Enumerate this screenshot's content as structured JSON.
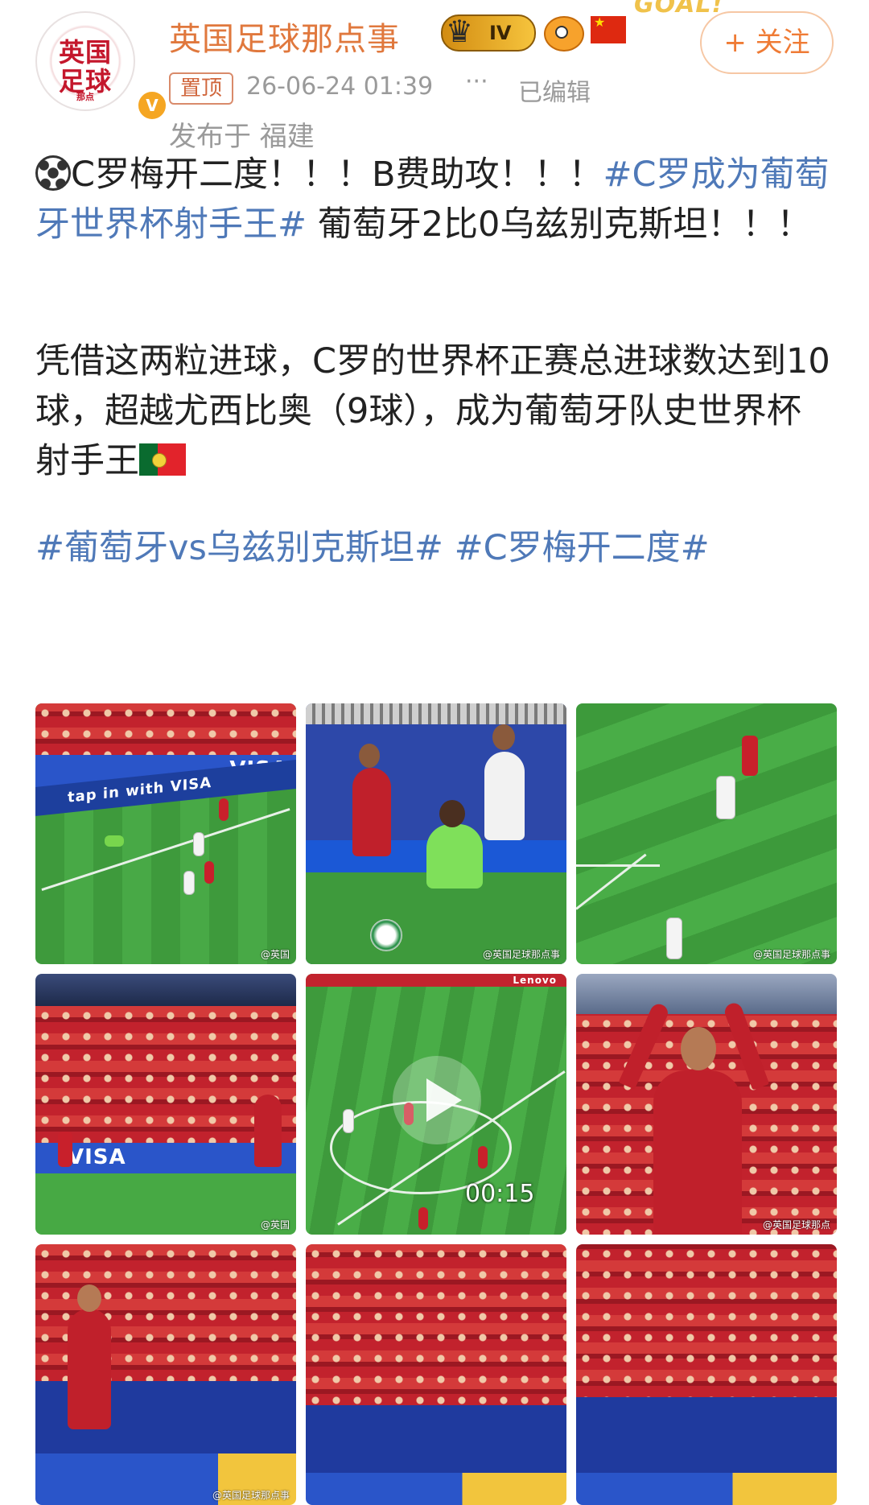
{
  "account": {
    "name": "英国足球那点事",
    "avatar_line1": "英国",
    "avatar_line2": "足球",
    "avatar_line3": "那点",
    "verified_mark": "V",
    "level": "IV",
    "sticker_text": "GOAL!"
  },
  "follow_button": "+ 关注",
  "meta": {
    "pinned": "置顶",
    "time": "26-06-24 01:39",
    "more": "···",
    "edited": "已编辑",
    "location": "发布于 福建"
  },
  "post": {
    "line1_text": "C罗梅开二度！！！B费助攻！！！",
    "line1_tag": "#C罗成为葡萄牙世界杯射手王#",
    "line1_tail": " 葡萄牙2比0乌兹别克斯坦！！！",
    "para2": "凭借这两粒进球，C罗的世界杯正赛总进球数达到10球，超越尤西比奥（9球），成为葡萄牙队史世界杯射手王",
    "tag1": "#葡萄牙vs乌兹别克斯坦#",
    "tag2": "#C罗梅开二度#"
  },
  "media": {
    "watermark_short": "@英国",
    "watermark_full": "@英国足球那点事",
    "watermark_mid": "@英国足球那点",
    "board_text_1": "tap in with VISA",
    "board_visa": "VISA",
    "board_lenovo": "Lenovo",
    "video_duration": "00:15"
  },
  "colors": {
    "username": "#e0783d",
    "hashtag": "#4f79b8",
    "follow": "#ef7b35",
    "meta_gray": "#9a9a9a"
  },
  "icons": [
    "soccer-ball-icon",
    "portugal-flag-icon",
    "china-flag-icon",
    "crown-level-badge",
    "play-icon"
  ]
}
